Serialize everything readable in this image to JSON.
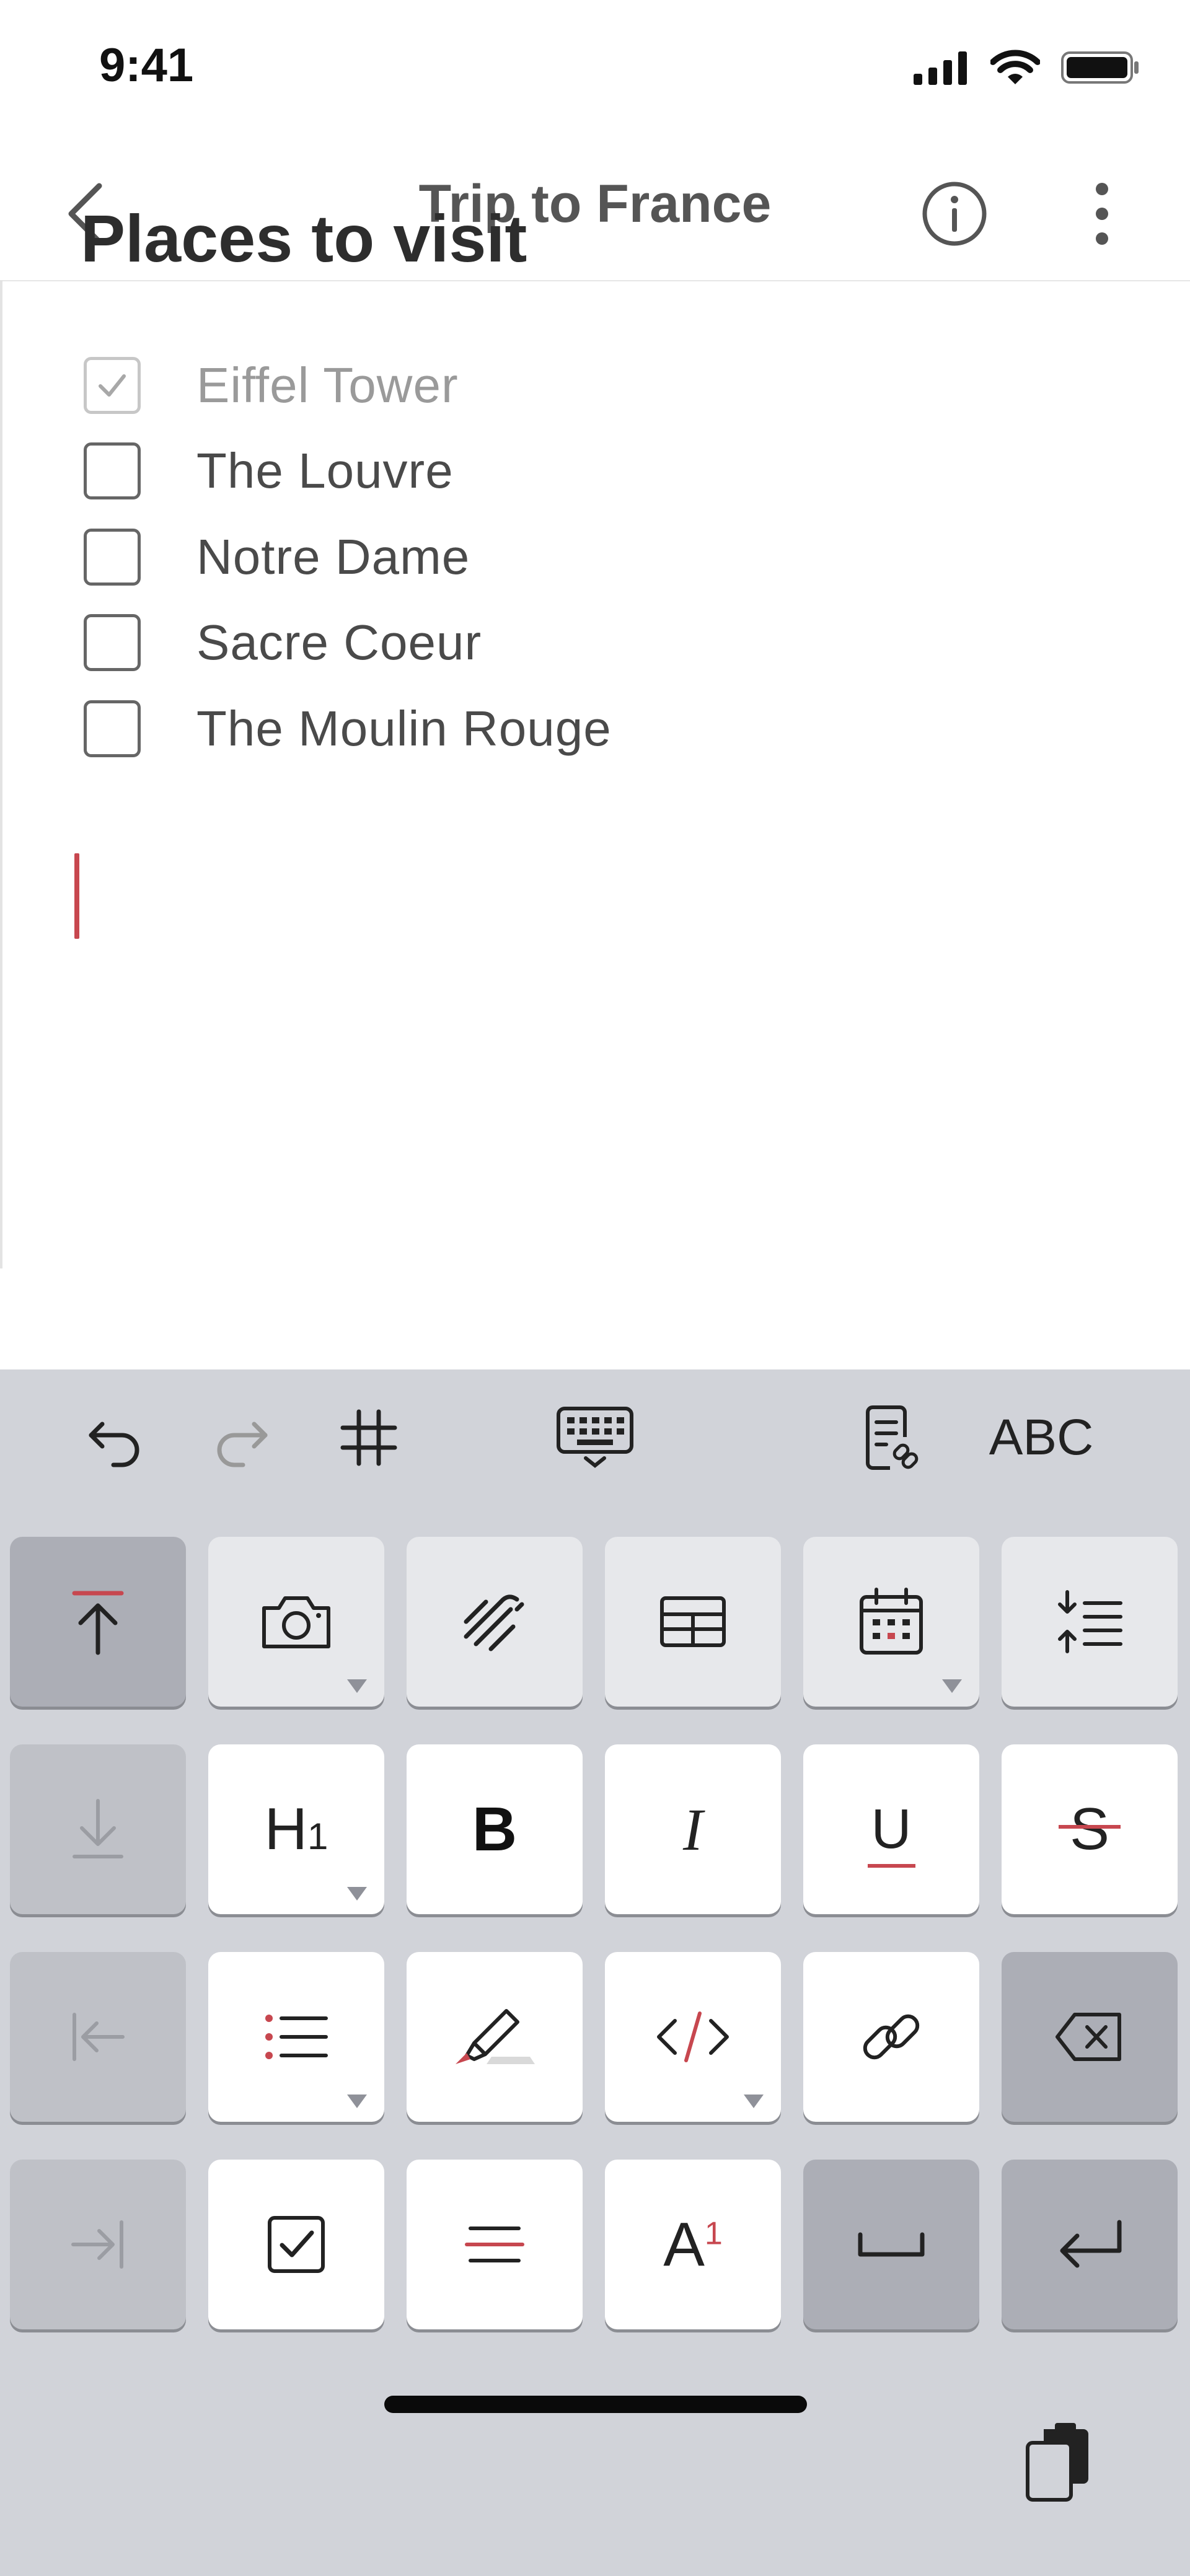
{
  "status": {
    "time": "9:41"
  },
  "nav": {
    "title": "Trip to France"
  },
  "note": {
    "heading": "Places to visit",
    "items": [
      {
        "label": "Eiffel Tower",
        "checked": true
      },
      {
        "label": "The Louvre",
        "checked": false
      },
      {
        "label": "Notre Dame",
        "checked": false
      },
      {
        "label": "Sacre Coeur",
        "checked": false
      },
      {
        "label": "The Moulin Rouge",
        "checked": false
      }
    ]
  },
  "toolbar": {
    "abc_label": "ABC"
  },
  "keys": {
    "h1_label": "H",
    "h1_sub": "1",
    "bold_label": "B",
    "italic_label": "I",
    "underline_label": "U",
    "strike_label": "S",
    "superscript_base": "A",
    "superscript_mark": "1"
  },
  "colors": {
    "accent": "#c7474f",
    "keyboard_bg": "#d1d3d9"
  }
}
